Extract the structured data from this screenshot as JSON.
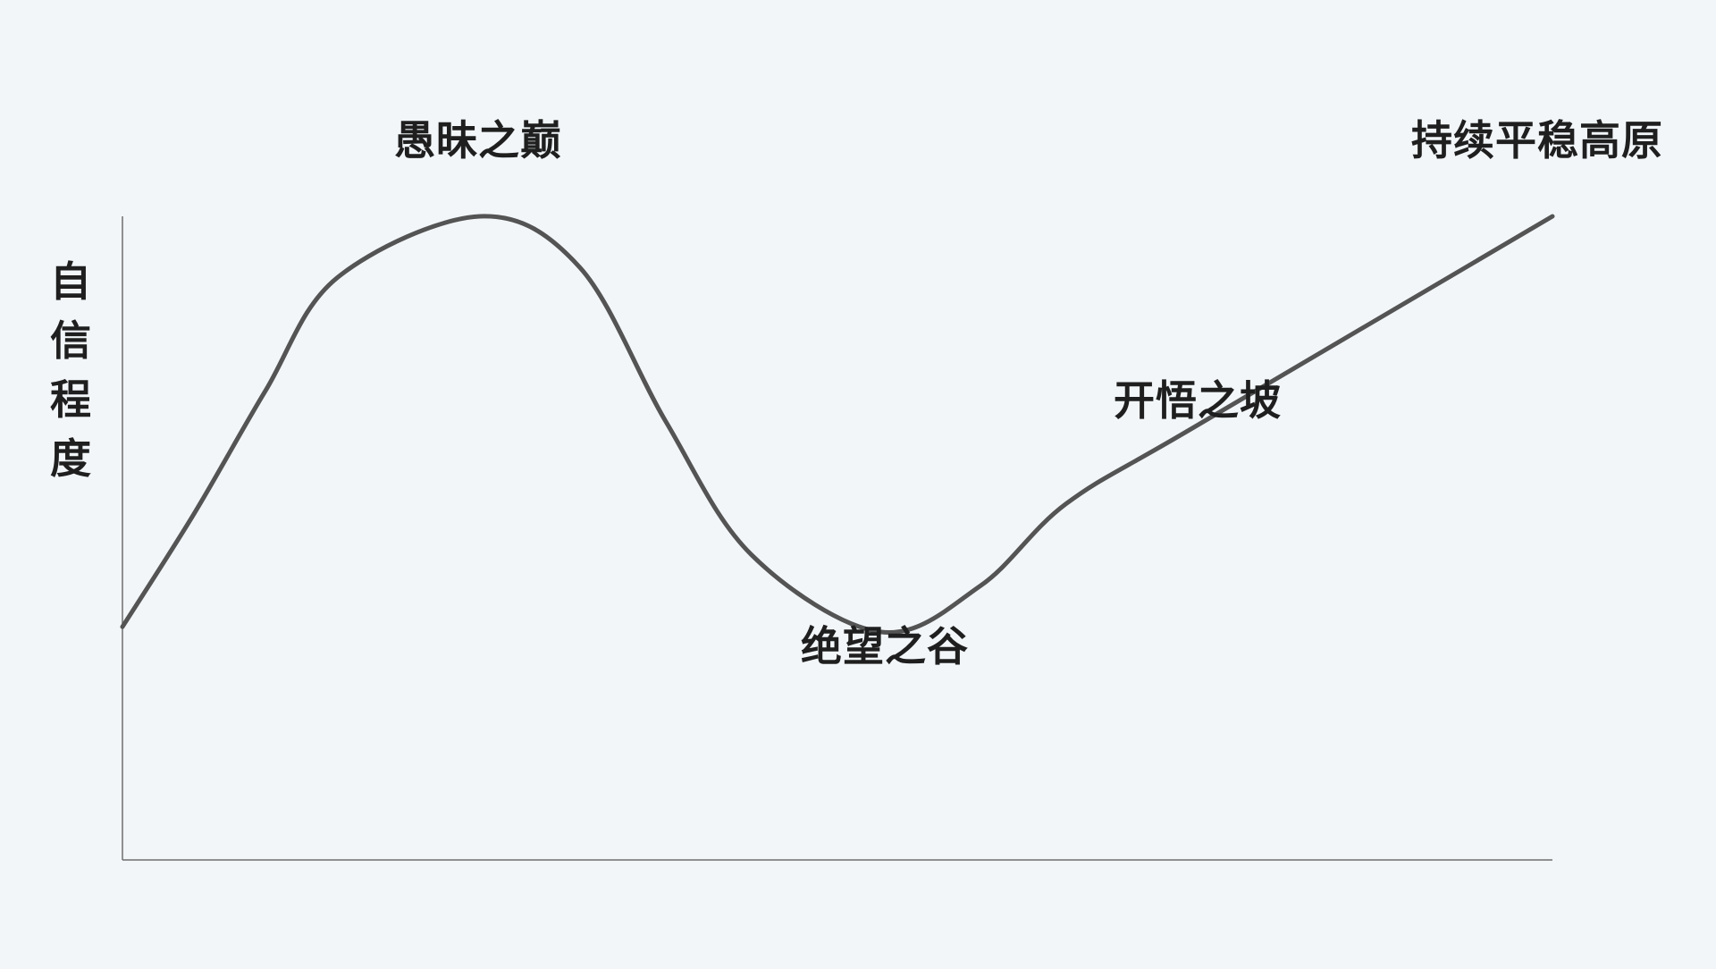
{
  "chart_data": {
    "type": "line",
    "title": "",
    "xlabel": "",
    "ylabel": "自信程度",
    "ylim": [
      0,
      100
    ],
    "grid": false,
    "series": [
      {
        "values_curve": [
          [
            0,
            20
          ],
          [
            5,
            42
          ],
          [
            10,
            66
          ],
          [
            15,
            88
          ],
          [
            25,
            100
          ],
          [
            32,
            90
          ],
          [
            38,
            60
          ],
          [
            44,
            34
          ],
          [
            53,
            19
          ],
          [
            60,
            28
          ],
          [
            66,
            44
          ],
          [
            75,
            59
          ],
          [
            100,
            100
          ]
        ]
      }
    ],
    "annotations": [
      {
        "text": "愚昧之巅",
        "x": 25,
        "y": 100
      },
      {
        "text": "绝望之谷",
        "x": 53,
        "y": 19
      },
      {
        "text": "开悟之坡",
        "x": 75,
        "y": 59
      },
      {
        "text": "持续平稳高原",
        "x": 100,
        "y": 100
      }
    ]
  },
  "colors": {
    "background": "#f2f6f9",
    "curve": "#545454",
    "text": "#1f1f1f",
    "axis": "#6e6e6e"
  }
}
